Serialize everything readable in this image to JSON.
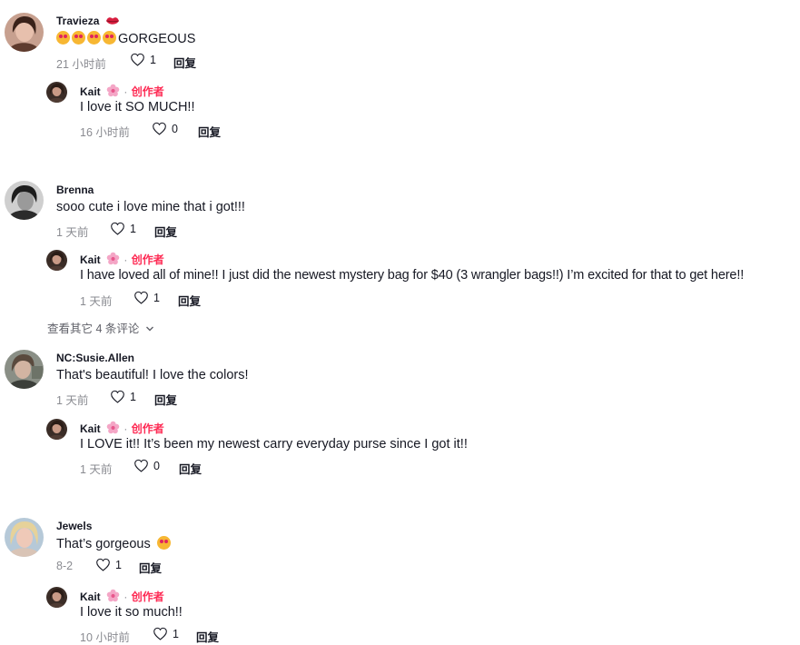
{
  "reply_label": "回复",
  "creator_label": "创作者",
  "threads": [
    {
      "user": "Travieza",
      "text": "GORGEOUS",
      "time": "21 小时前",
      "likes": "1",
      "reply": {
        "user": "Kait",
        "text": "I love it SO MUCH!!",
        "time": "16 小时前",
        "likes": "0"
      }
    },
    {
      "user": "Brenna",
      "text": "sooo cute i love mine that i got!!!",
      "time": "1 天前",
      "likes": "1",
      "reply": {
        "user": "Kait",
        "text": "I have loved all of mine!! I just did the newest mystery bag for $40 (3 wrangler bags!!) I’m excited for that to get here!!",
        "time": "1 天前",
        "likes": "1"
      },
      "more_replies": "查看其它 4 条评论"
    },
    {
      "user": "NC:Susie.Allen",
      "text": "That's beautiful! I love the colors!",
      "time": "1 天前",
      "likes": "1",
      "reply": {
        "user": "Kait",
        "text": "I LOVE it!! It’s been my newest carry everyday purse since I got it!!",
        "time": "1 天前",
        "likes": "0"
      }
    },
    {
      "user": "Jewels",
      "text": "That’s gorgeous",
      "time": "8-2",
      "likes": "1",
      "reply": {
        "user": "Kait",
        "text": "I love it so much!!",
        "time": "10 小时前",
        "likes": "1"
      }
    }
  ],
  "colors": {
    "creator": "#fe2c55",
    "meta": "#8a8b91",
    "text": "#161823"
  },
  "icons": [
    "heart-outline-icon",
    "lips-icon",
    "flower-badge-icon",
    "heart-eyes-emoji",
    "chevron-down-icon"
  ]
}
